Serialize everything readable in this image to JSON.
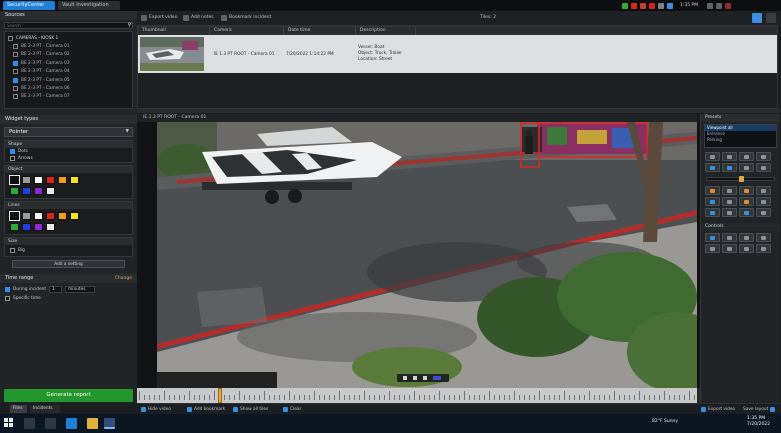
{
  "titlebar": {
    "tabs": [
      {
        "label": "SecurityCenter"
      },
      {
        "label": "Vault Investigation"
      }
    ],
    "clock": "1:35 PM"
  },
  "left_panel": {
    "sources_title": "Sources",
    "search_placeholder": "Search",
    "tree": [
      {
        "label": "CAMERAS - KIOSK 1",
        "checked": false,
        "root": true
      },
      {
        "label": "BE 2-3 PT - Camera 01",
        "checked": false
      },
      {
        "label": "BE 2-3 PT - Camera 02",
        "checked": false
      },
      {
        "label": "BE 2-3 PT - Camera 03",
        "checked": true
      },
      {
        "label": "BE 2-3 PT - Camera 04",
        "checked": false
      },
      {
        "label": "BE 2-3 PT - Camera 05",
        "checked": true
      },
      {
        "label": "BE 2-3 PT - Camera 06",
        "checked": false
      },
      {
        "label": "BE 2-3 PT - Camera 07",
        "checked": false
      }
    ],
    "widget_title": "Widget types",
    "widget_type": "Pointer",
    "shape": {
      "title": "Shape",
      "options": [
        {
          "label": "Dots",
          "on": true
        },
        {
          "label": "Arrows",
          "on": false
        }
      ]
    },
    "fill_color": {
      "title": "Object",
      "colors": [
        "#111111",
        "#9a9a9a",
        "#ffffff",
        "#d9231b",
        "#f39b1a",
        "#f6e51c",
        "#2fad3a",
        "#1f3fe0",
        "#8b2ad6",
        "#e9e9e9"
      ]
    },
    "line_color": {
      "title": "Lines",
      "colors": [
        "#111111",
        "#9a9a9a",
        "#ffffff",
        "#d9231b",
        "#f39b1a",
        "#f6e51c",
        "#2fad3a",
        "#1f3fe0",
        "#8b2ad6",
        "#e9e9e9"
      ]
    },
    "size": {
      "title": "Size",
      "options": [
        {
          "label": "Big",
          "on": false
        }
      ]
    },
    "apply_label": "Add a setting",
    "time_range_title": "Time range",
    "time_range_link": "Change",
    "time_rows": [
      {
        "label": "During incident",
        "value1": "1",
        "value2": "minutes"
      },
      {
        "label": "Specific time",
        "value1": "",
        "value2": ""
      }
    ],
    "export_label": "Generate report",
    "bottom_tabs": [
      "Files",
      "Incidents"
    ]
  },
  "toolbar": {
    "items": [
      "Export video",
      "Add notes",
      "Bookmark incident"
    ],
    "right_label": "Tiles: 2"
  },
  "alarm_table": {
    "columns": [
      "Thumbnail",
      "Camera",
      "Date time",
      "Description"
    ],
    "row": {
      "camera": "IE 1.3 PT ROOT - Camera 01",
      "datetime": "7/20/2022 1:14:22 PM",
      "desc_lines": [
        "Vessel: Boat",
        "Object: Truck, Trailer",
        "Location: Street"
      ]
    }
  },
  "video": {
    "title": "IE 1.3 PT ROOT - Camera 01"
  },
  "ptz": {
    "title": "Presets",
    "presets": [
      {
        "label": "Viewpoint all",
        "selected": true
      },
      {
        "label": "Entrance",
        "selected": false
      },
      {
        "label": "Parking",
        "selected": false
      }
    ],
    "section_label": "Controls"
  },
  "bottom_strip": {
    "items": [
      "Hide video",
      "Add bookmark",
      "Show all tiles",
      "Clear"
    ],
    "right_items": [
      "Export video",
      "Save layout"
    ]
  },
  "taskbar": {
    "temp": "82°F Sunny",
    "time": "1:35 PM",
    "date": "7/20/2022"
  }
}
